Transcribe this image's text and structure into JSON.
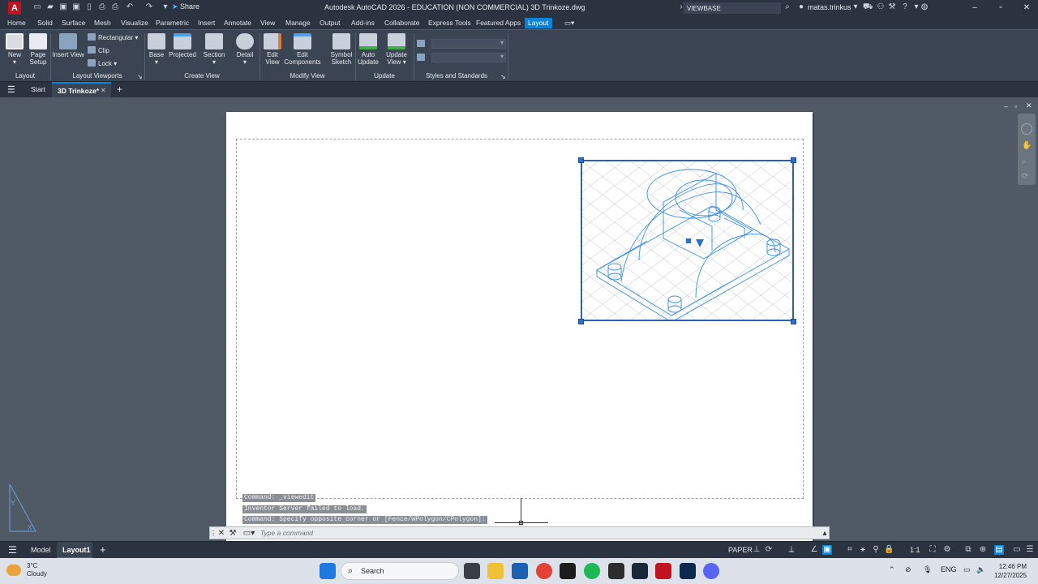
{
  "titlebar": {
    "logo": "A",
    "title": "Autodesk AutoCAD 2026 - EDUCATION (NON COMMERCIAL)    3D Trinkoze.dwg",
    "share": "Share",
    "search_value": "VIEWBASE",
    "user": "matas.trinkus"
  },
  "ribbon_tabs": [
    "Home",
    "Solid",
    "Surface",
    "Mesh",
    "Visualize",
    "Parametric",
    "Insert",
    "Annotate",
    "View",
    "Manage",
    "Output",
    "Add-ins",
    "Collaborate",
    "Express Tools",
    "Featured Apps",
    "Layout"
  ],
  "active_tab": "Layout",
  "ribbon": {
    "layout_group": {
      "label": "Layout",
      "new": "New",
      "page_setup_1": "Page",
      "page_setup_2": "Setup"
    },
    "viewports_group": {
      "label": "Layout Viewports",
      "insert_view": "Insert View",
      "rectangular": "Rectangular",
      "clip": "Clip",
      "lock": "Lock"
    },
    "create_view_group": {
      "label": "Create View",
      "base": "Base",
      "projected": "Projected",
      "section": "Section",
      "detail": "Detail"
    },
    "modify_view_group": {
      "label": "Modify View",
      "edit_view_1": "Edit",
      "edit_view_2": "View",
      "edit_components_1": "Edit",
      "edit_components_2": "Components",
      "symbol_sketch_1": "Symbol",
      "symbol_sketch_2": "Sketch"
    },
    "update_group": {
      "label": "Update",
      "auto_update_1": "Auto",
      "auto_update_2": "Update",
      "update_view_1": "Update",
      "update_view_2": "View"
    },
    "styles_group": {
      "label": "Styles and Standards"
    }
  },
  "file_tabs": {
    "start": "Start",
    "current": "3D Trinkoze*"
  },
  "command_history": [
    "Command: _viewedit",
    "Inventor Server failed to load.",
    "Command: Specify opposite corner or [Fence/WPolygon/CPolygon]:"
  ],
  "command_line": {
    "placeholder": "Type a command"
  },
  "layout_tabs": {
    "model": "Model",
    "layout1": "Layout1"
  },
  "status": {
    "paper": "PAPER",
    "scale": "1:1"
  },
  "taskbar": {
    "weather_temp": "3°C",
    "weather_desc": "Cloudy",
    "search": "Search",
    "lang": "ENG",
    "time": "12:46 PM",
    "date": "12/27/2025"
  },
  "colors": {
    "accent": "#0a84d6",
    "viewport_frame": "#2a62b8",
    "drawing_lines": "#3a8ee6"
  }
}
